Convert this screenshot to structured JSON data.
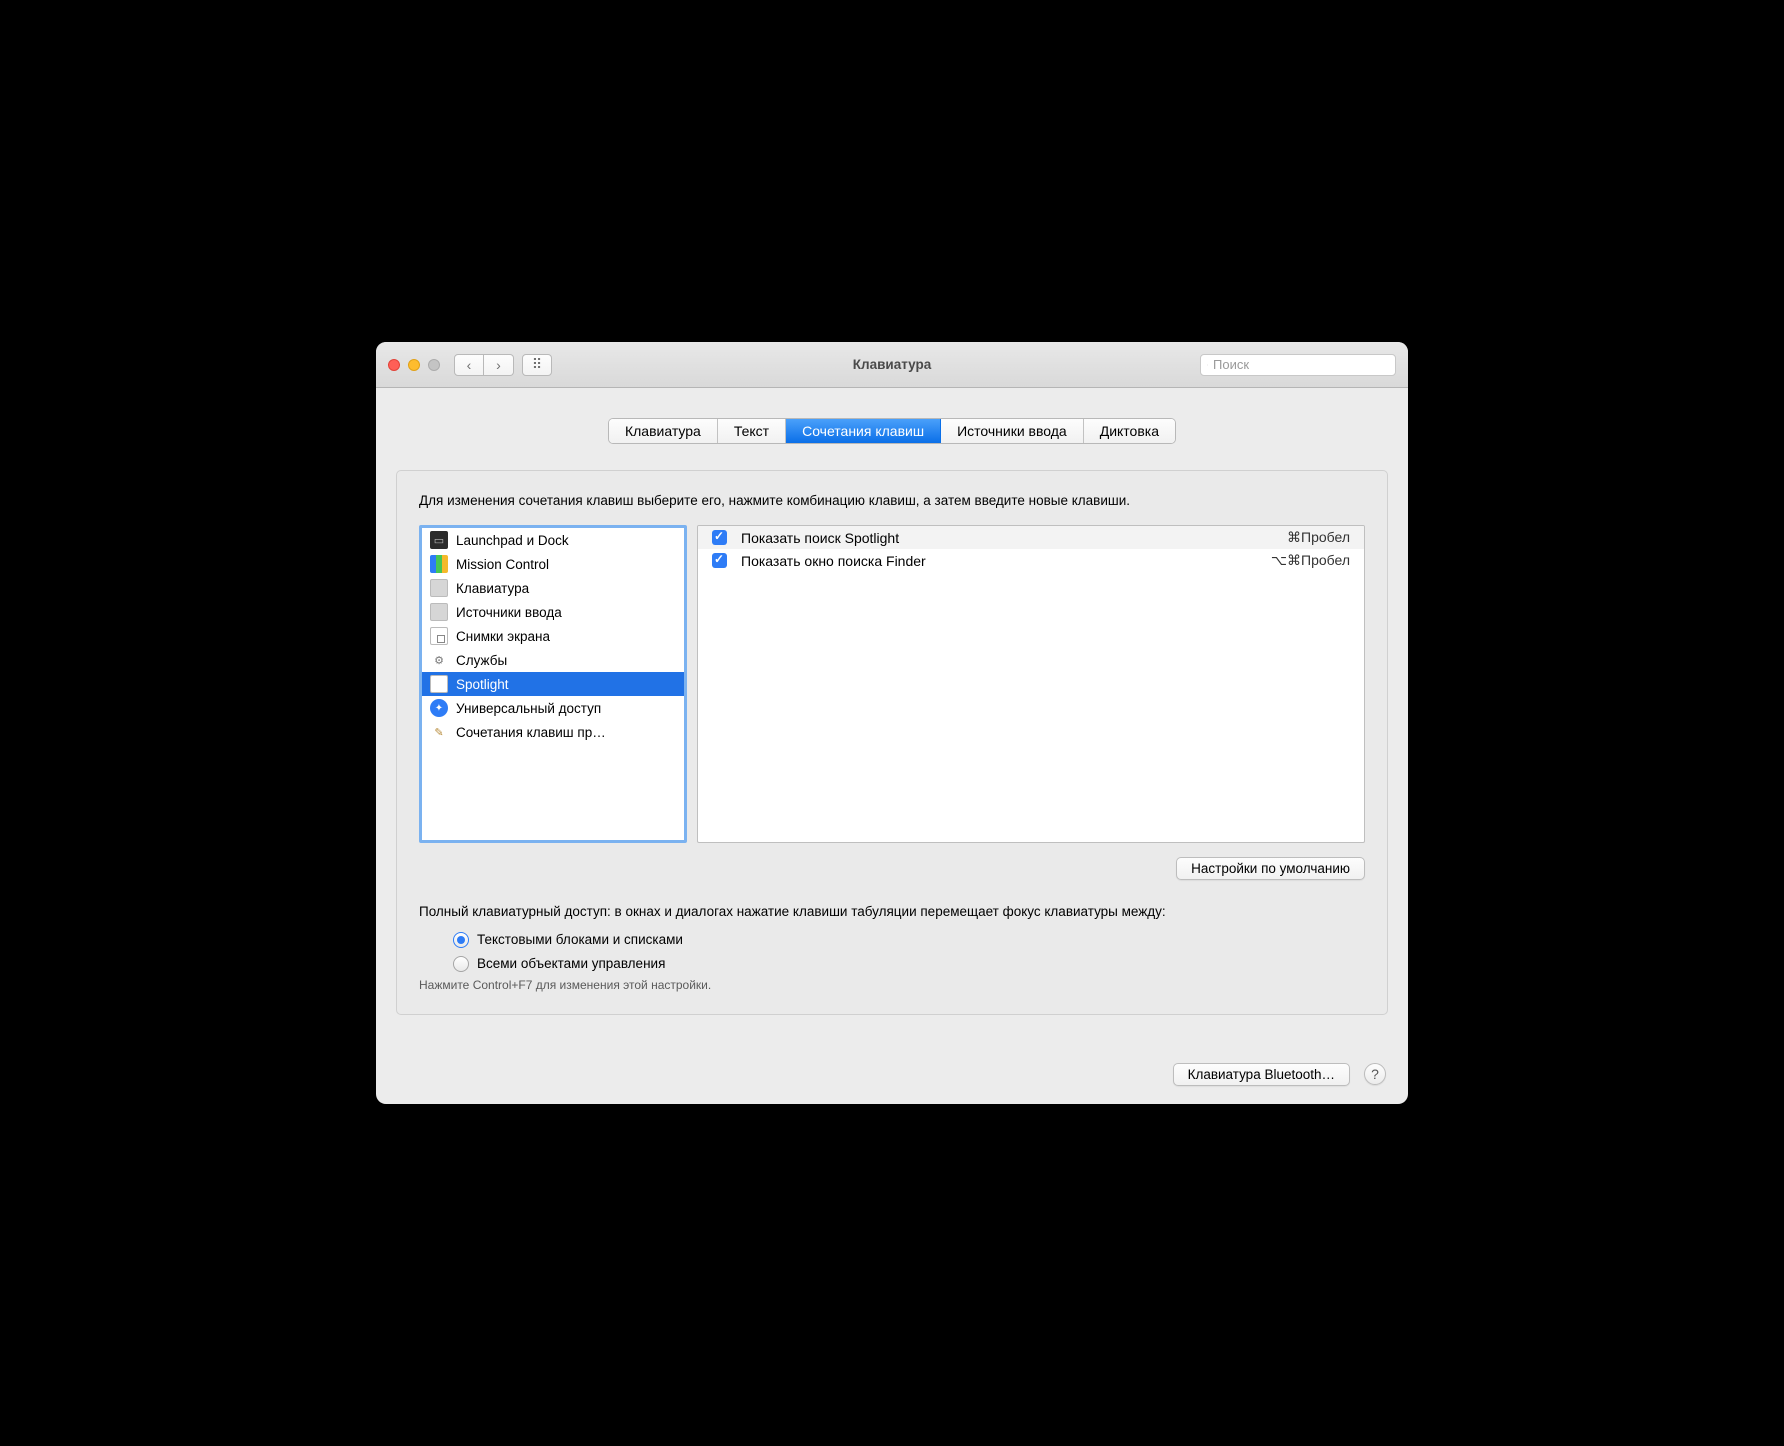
{
  "window": {
    "title": "Клавиатура"
  },
  "search": {
    "placeholder": "Поиск"
  },
  "tabs": [
    {
      "label": "Клавиатура",
      "active": false
    },
    {
      "label": "Текст",
      "active": false
    },
    {
      "label": "Сочетания клавиш",
      "active": true
    },
    {
      "label": "Источники ввода",
      "active": false
    },
    {
      "label": "Диктовка",
      "active": false
    }
  ],
  "instruction": "Для изменения сочетания клавиш выберите его, нажмите комбинацию клавиш, а затем введите новые клавиши.",
  "sidebar": {
    "items": [
      {
        "label": "Launchpad и Dock",
        "icon": "launchpad",
        "selected": false
      },
      {
        "label": "Mission Control",
        "icon": "mission",
        "selected": false
      },
      {
        "label": "Клавиатура",
        "icon": "keyboard",
        "selected": false
      },
      {
        "label": "Источники ввода",
        "icon": "input",
        "selected": false
      },
      {
        "label": "Снимки экрана",
        "icon": "screenshot",
        "selected": false
      },
      {
        "label": "Службы",
        "icon": "gear",
        "selected": false
      },
      {
        "label": "Spotlight",
        "icon": "doc",
        "selected": true
      },
      {
        "label": "Универсальный доступ",
        "icon": "access",
        "selected": false
      },
      {
        "label": "Сочетания клавиш пр…",
        "icon": "app",
        "selected": false
      }
    ]
  },
  "shortcuts": [
    {
      "checked": true,
      "label": "Показать поиск Spotlight",
      "keys": "⌘Пробел"
    },
    {
      "checked": true,
      "label": "Показать окно поиска Finder",
      "keys": "⌥⌘Пробел"
    }
  ],
  "buttons": {
    "defaults": "Настройки по умолчанию",
    "bluetooth": "Клавиатура Bluetooth…"
  },
  "access": {
    "text": "Полный клавиатурный доступ: в окнах и диалогах нажатие клавиши табуляции перемещает фокус клавиатуры между:",
    "opt1": "Текстовыми блоками и списками",
    "opt2": "Всеми объектами управления",
    "hint": "Нажмите Control+F7 для изменения этой настройки."
  }
}
